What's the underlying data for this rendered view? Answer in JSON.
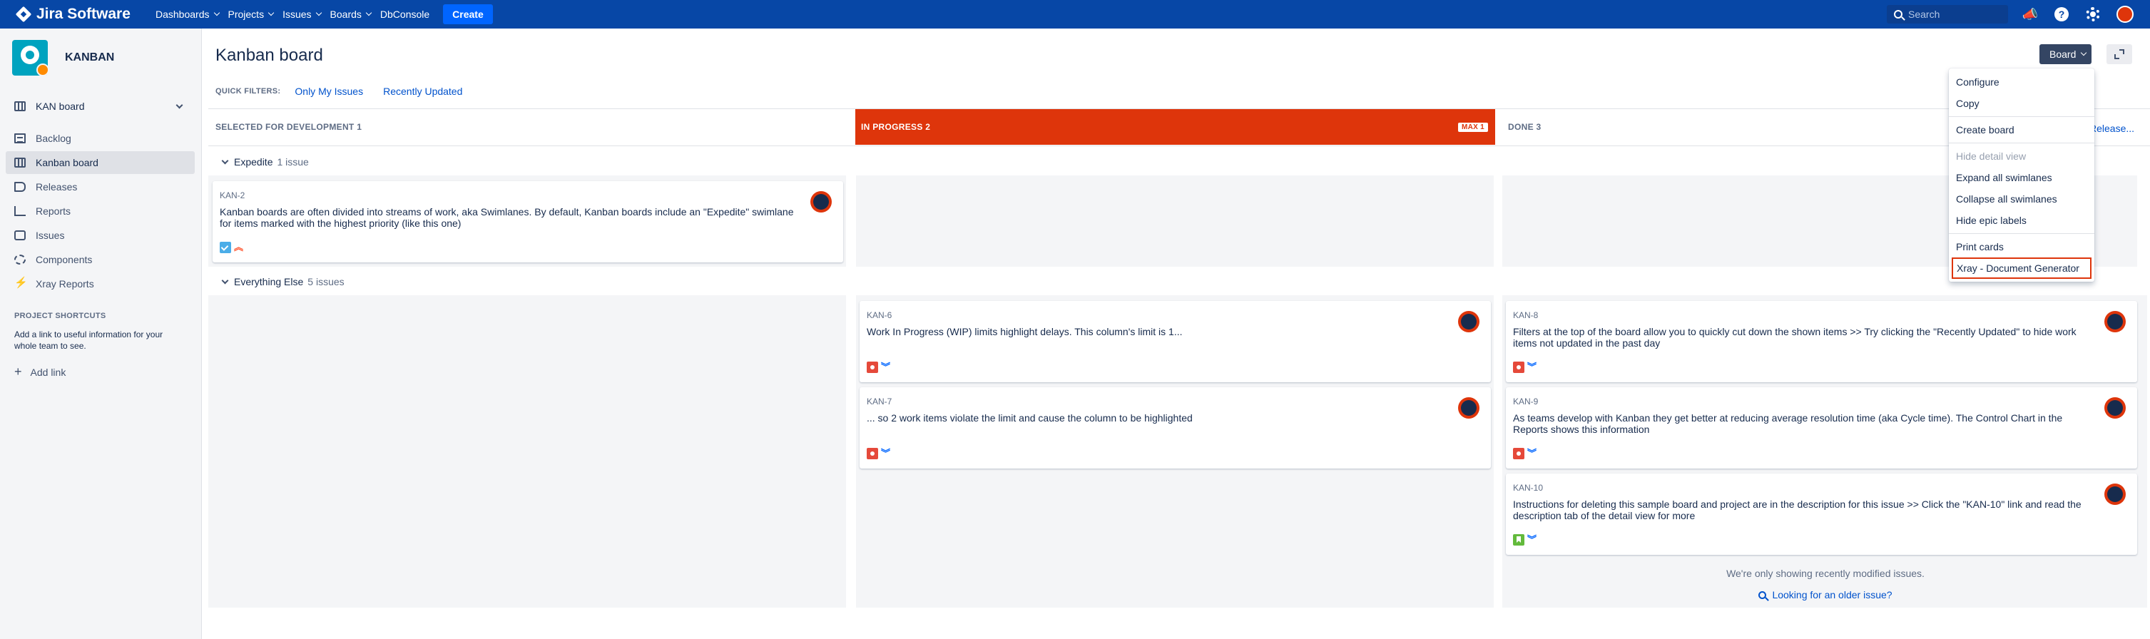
{
  "nav": {
    "logo": "Jira Software",
    "items": [
      "Dashboards",
      "Projects",
      "Issues",
      "Boards"
    ],
    "dbconsole": "DbConsole",
    "create": "Create",
    "search_placeholder": "Search"
  },
  "sidebar": {
    "project_name": "KANBAN",
    "board_select": "KAN board",
    "items": [
      {
        "label": "Backlog",
        "icon": "backlog-icon"
      },
      {
        "label": "Kanban board",
        "icon": "board-icon",
        "active": true
      },
      {
        "label": "Releases",
        "icon": "release-icon"
      },
      {
        "label": "Reports",
        "icon": "reports-icon"
      },
      {
        "label": "Issues",
        "icon": "issues-icon"
      },
      {
        "label": "Components",
        "icon": "components-icon"
      },
      {
        "label": "Xray Reports",
        "icon": "xray-icon"
      }
    ],
    "shortcuts_title": "PROJECT SHORTCUTS",
    "shortcuts_desc": "Add a link to useful information for your whole team to see.",
    "add_link": "Add link"
  },
  "header": {
    "title": "Kanban board",
    "board_button": "Board",
    "quick_filters_title": "QUICK FILTERS:",
    "quick_filters": [
      "Only My Issues",
      "Recently Updated"
    ]
  },
  "columns": [
    {
      "name": "SELECTED FOR DEVELOPMENT",
      "count": "1"
    },
    {
      "name": "IN PROGRESS",
      "count": "2",
      "badge": "MAX 1",
      "color": "#de350b"
    },
    {
      "name": "DONE",
      "count": "3",
      "release_link": "Release..."
    }
  ],
  "swimlanes": [
    {
      "name": "Expedite",
      "count": "1 issue"
    },
    {
      "name": "Everything Else",
      "count": "5 issues"
    }
  ],
  "cards": [
    {
      "key": "KAN-2",
      "summary": "Kanban boards are often divided into streams of work, aka Swimlanes. By default, Kanban boards include an \"Expedite\" swimlane for items marked with the highest priority (like this one)",
      "type": "task",
      "priority": "highest"
    },
    {
      "key": "KAN-6",
      "summary": "Work In Progress (WIP) limits highlight delays. This column's limit is 1...",
      "type": "bug",
      "priority": "low"
    },
    {
      "key": "KAN-7",
      "summary": "... so 2 work items violate the limit and cause the column to be highlighted",
      "type": "bug",
      "priority": "low"
    },
    {
      "key": "KAN-8",
      "summary": "Filters at the top of the board allow you to quickly cut down the shown items >> Try clicking the \"Recently Updated\" to hide work items not updated in the past day",
      "type": "bug",
      "priority": "low"
    },
    {
      "key": "KAN-9",
      "summary": "As teams develop with Kanban they get better at reducing average resolution time (aka Cycle time). The Control Chart in the Reports shows this information",
      "type": "bug",
      "priority": "low"
    },
    {
      "key": "KAN-10",
      "summary": "Instructions for deleting this sample board and project are in the description for this issue >> Click the \"KAN-10\" link and read the description tab of the detail view for more",
      "type": "story",
      "priority": "low"
    }
  ],
  "done_footer": {
    "note": "We're only showing recently modified issues.",
    "link": "Looking for an older issue?"
  },
  "menu": {
    "items": [
      "Configure",
      "Copy",
      "Create board",
      "Hide detail view",
      "Expand all swimlanes",
      "Collapse all swimlanes",
      "Hide epic labels",
      "Print cards",
      "Xray - Document Generator"
    ]
  }
}
